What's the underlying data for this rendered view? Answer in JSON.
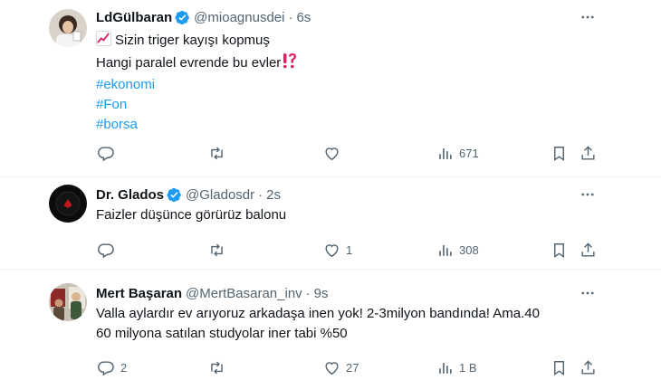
{
  "tweets": [
    {
      "name": "LdGülbaran",
      "handle": "@mioagnusdei",
      "time": "6s",
      "body": {
        "line1": "Sizin triger kayışı kopmuş",
        "line2": "Hangi paralel evrende bu evler",
        "hashtags": [
          "#ekonomi",
          "#Fon",
          "#borsa"
        ]
      },
      "actions": {
        "reply": "",
        "retweet": "",
        "like": "",
        "views": "671"
      }
    },
    {
      "name": "Dr. Glados",
      "handle": "@Gladosdr",
      "time": "2s",
      "body": {
        "line1": "Faizler düşünce görürüz balonu"
      },
      "actions": {
        "reply": "",
        "retweet": "",
        "like": "1",
        "views": "308"
      }
    },
    {
      "name": "Mert Başaran",
      "handle": "@MertBasaran_inv",
      "time": "9s",
      "body": {
        "line1": "Valla aylardır ev arıyoruz arkadaşa inen yok! 2-3milyon bandında! Ama.40",
        "line2": "60 milyona satılan studyolar iner tabi %50"
      },
      "actions": {
        "reply": "2",
        "retweet": "",
        "like": "27",
        "views": "1 B"
      }
    }
  ],
  "separator": "·",
  "colors": {
    "accent": "#1d9bf0",
    "text": "#0f1419",
    "secondary": "#536471",
    "divider": "#eff3f4"
  },
  "icons": [
    "verified-icon",
    "more-icon",
    "reply-icon",
    "retweet-icon",
    "like-icon",
    "views-icon",
    "bookmark-icon",
    "share-icon",
    "chart-emoji-icon",
    "exclamation-question-emoji-icon"
  ]
}
